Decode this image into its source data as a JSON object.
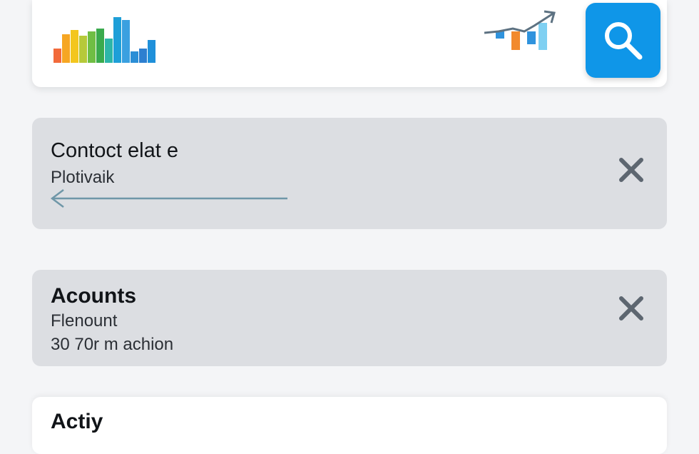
{
  "header": {
    "logo_icon": "bar-chart-logo-icon",
    "trend_icon": "trending-up-chart-icon",
    "search_icon": "search-icon",
    "search_color": "#0f96e8"
  },
  "cards": [
    {
      "title": "Contoct elat e",
      "lines": [
        "Plotivaik"
      ],
      "icons": [
        "back-arrow-icon",
        "close-icon"
      ]
    },
    {
      "title": "Acounts",
      "lines": [
        "Flenount",
        "30 70r m achion"
      ],
      "icons": [
        "close-icon"
      ]
    },
    {
      "title": "Actiy"
    }
  ]
}
